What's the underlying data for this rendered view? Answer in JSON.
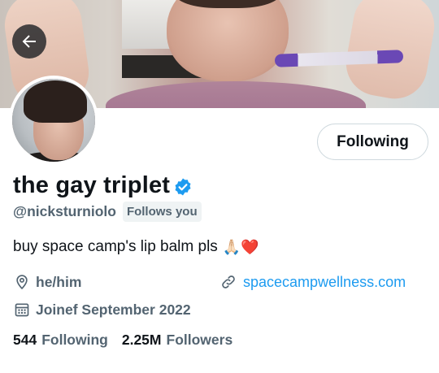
{
  "profile": {
    "display_name": "the gay triplet",
    "handle": "@nickst​urniolo",
    "follows_you": "Follows you",
    "bio_text": "buy space camp's lip balm pls",
    "bio_emojis": "🙏🏻❤️",
    "pronouns": "he/him",
    "website": "spacecampwellness.com",
    "joined": "Joinef September 2022",
    "following_count": "544",
    "following_label": "Following",
    "followers_count": "2.25M",
    "followers_label": "Followers"
  },
  "actions": {
    "follow_state_label": "Following"
  },
  "icons": {
    "back": "back-arrow-icon",
    "verified": "verified-badge-icon",
    "location": "location-pin-icon",
    "link": "link-icon",
    "calendar": "calendar-icon"
  },
  "colors": {
    "accent": "#1d9bf0",
    "secondary_text": "#536471",
    "primary_text": "#0f1419"
  }
}
